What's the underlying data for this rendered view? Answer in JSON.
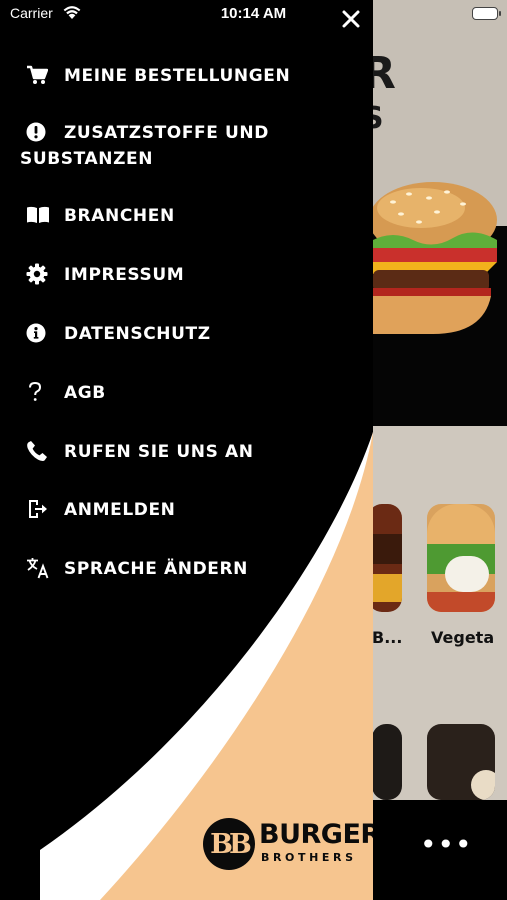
{
  "status_bar": {
    "carrier": "Carrier",
    "time": "10:14 AM"
  },
  "drawer": {
    "menu": [
      {
        "label": "MEINE BESTELLUNGEN",
        "icon": "cart-icon"
      },
      {
        "label_line1": "ZUSATZSTOFFE UND",
        "label_line2": "SUBSTANZEN",
        "icon": "alert-circle-icon"
      },
      {
        "label": "BRANCHEN",
        "icon": "open-book-icon"
      },
      {
        "label": "IMPRESSUM",
        "icon": "gear-icon"
      },
      {
        "label": "DATENSCHUTZ",
        "icon": "info-circle-icon"
      },
      {
        "label": "AGB",
        "icon": "question-mark-icon"
      },
      {
        "label": "RUFEN SIE UNS AN",
        "icon": "phone-icon"
      },
      {
        "label": "ANMELDEN",
        "icon": "login-icon"
      },
      {
        "label": "SPRACHE ÄNDERN",
        "icon": "translate-icon"
      }
    ],
    "brand": {
      "mark": "BB",
      "word1": "BURGER",
      "word2": "BROTHERS"
    }
  },
  "background": {
    "category_labels": [
      "B...",
      "Vegeta"
    ],
    "more_label": "•••"
  },
  "colors": {
    "drawer_bg": "#000000",
    "accent_peach": "#f6c58f",
    "text_white": "#ffffff"
  }
}
